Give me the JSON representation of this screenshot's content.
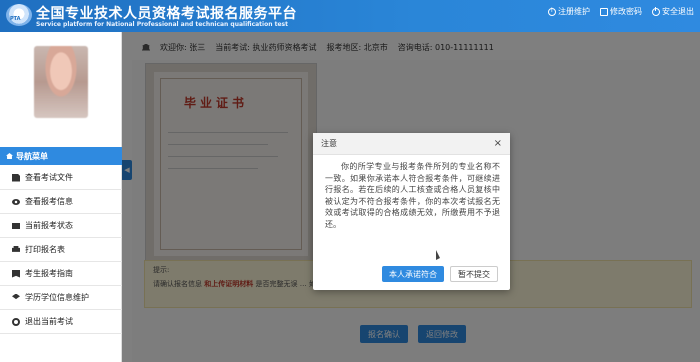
{
  "header": {
    "logo_text": "PTA",
    "title_cn": "全国专业技术人员资格考试报名服务平台",
    "title_en": "Service platform for National Professional and technican qualification test",
    "links": [
      {
        "label": "注册维护",
        "icon": "info-icon"
      },
      {
        "label": "修改密码",
        "icon": "edit-icon"
      },
      {
        "label": "安全退出",
        "icon": "power-icon"
      }
    ]
  },
  "sidebar": {
    "menu_title": "导航菜单",
    "collapse_glyph": "◀",
    "items": [
      {
        "label": "查看考试文件",
        "icon": "document-icon"
      },
      {
        "label": "查看报考信息",
        "icon": "eye-icon"
      },
      {
        "label": "当前报考状态",
        "icon": "monitor-icon"
      },
      {
        "label": "打印报名表",
        "icon": "print-icon"
      },
      {
        "label": "考生报考指南",
        "icon": "book-icon"
      },
      {
        "label": "学历学位信息维护",
        "icon": "graduation-cap-icon"
      },
      {
        "label": "退出当前考试",
        "icon": "exit-icon"
      }
    ]
  },
  "infobar": {
    "welcome": "欢迎你: 张三",
    "exam": "当前考试: 执业药师资格考试",
    "region": "报考地区: 北京市",
    "phone": "咨询电话: 010-11111111"
  },
  "certificate": {
    "title": "毕业证书"
  },
  "note": {
    "label": "提示:",
    "text_before": "请确认报名信息",
    "highlight": "和上传证明材料",
    "text_after": "是否完整无误 … 如需修改，请点击\"返回修改\"按钮进行信息修改。"
  },
  "buttons": {
    "confirm": "报名确认",
    "back": "返回修改"
  },
  "modal": {
    "title": "注意",
    "close": "×",
    "body": "你的所学专业与报考条件所列的专业名称不一致。如果你承诺本人符合报考条件，可继续进行报名。若在后续的人工核查或合格人员复核中被认定为不符合报考条件，你的本次考试报名无效或考试取得的合格成绩无效，所缴费用不予退还。",
    "primary_button": "本人承诺符合",
    "secondary_button": "暂不提交"
  }
}
